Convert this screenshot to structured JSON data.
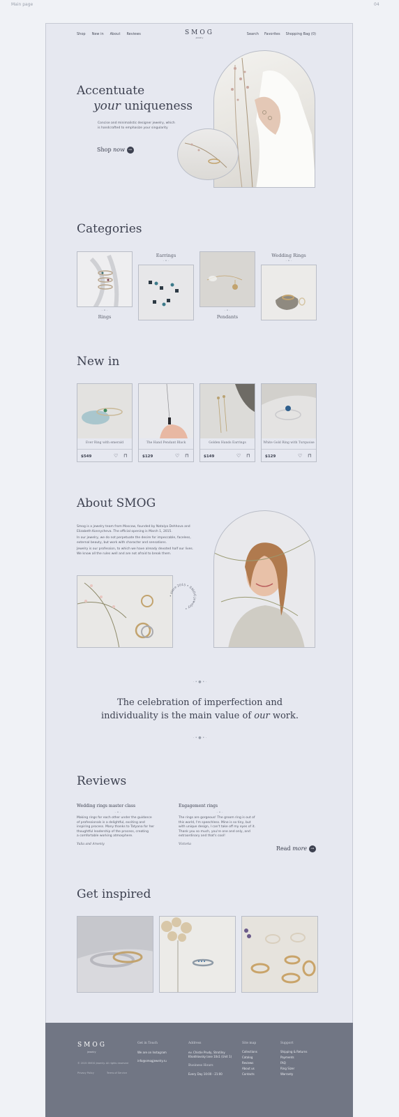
{
  "canvas": {
    "label": "Main page",
    "page_number": "04"
  },
  "nav": {
    "left": [
      "Shop",
      "New in",
      "About",
      "Reviews"
    ],
    "logo": "SMOG",
    "logo_sub": "jewelry",
    "right": [
      "Search",
      "Favorites",
      "Shopping Bag (0)"
    ]
  },
  "hero": {
    "title_line1": "Accentuate",
    "title_em": "your",
    "title_rest": "uniqueness",
    "subtitle_line1": "Concise and minimalistic designer jewelry, which",
    "subtitle_line2": "is handcrafted to emphasize your singularity",
    "cta_text": "Shop",
    "cta_em": "now",
    "cta_icon": "arrow-right-icon"
  },
  "categories": {
    "title": "Categories",
    "items": [
      {
        "label": "Rings"
      },
      {
        "label": "Earrings"
      },
      {
        "label": "Pendants"
      },
      {
        "label": "Wedding Rings"
      }
    ]
  },
  "new_in": {
    "title": "New in",
    "products": [
      {
        "name": "Ever Ring with emerald",
        "price": "$549"
      },
      {
        "name": "The Hand Pendant Black",
        "price": "$129"
      },
      {
        "name": "Golden Hands Earrings",
        "price": "$149"
      },
      {
        "name": "White Gold Ring with Turquoise",
        "price": "$129"
      }
    ]
  },
  "about": {
    "title": "About SMOG",
    "p1_lines": [
      "Smog is a jewelry team from Moscow, founded by Natalya Dehhova and",
      "Elizabeth Konnycheva. The official opening is March 1, 2015."
    ],
    "p2_lines": [
      "In our jewelry, we do not perpetuate the desire for impeccable, faceless,",
      "external beauty, but work with character and sensations."
    ],
    "p3_lines": [
      "Jewelry is our profession, to which we have already devoted half our lives.",
      "We know all the rules well and are not afraid to break them."
    ],
    "stamp": "• since 2015 • SMOG jewelry •"
  },
  "quote": {
    "line1": "The celebration of imperfection and",
    "line2_pre": "individuality is the main value of",
    "line2_em": "our",
    "line2_post": "work."
  },
  "reviews": {
    "title": "Reviews",
    "items": [
      {
        "heading": "Wedding rings master class",
        "lines": [
          "Making rings for each other under the guidance",
          "of professionals is a delightful, exciting and",
          "inspiring process. Many thanks to Tatyana for her",
          "thoughtful leadership of the process, creating",
          "a comfortable working atmosphere."
        ],
        "author": "Yulia and Arseniy"
      },
      {
        "heading": "Engagement rings",
        "lines": [
          "The rings are gorgeous! The groom ring is out of",
          "this world, I'm speechless. Mine is so tiny, but",
          "with unique design, I can't take off my eyes of it.",
          "Thank you so much, you're one and only, and",
          "extraordinary and that's cool!"
        ],
        "author": "Victoria"
      }
    ],
    "read_more": "Read",
    "read_more_em": "more"
  },
  "inspired": {
    "title": "Get inspired"
  },
  "footer": {
    "logo": "SMOG",
    "logo_sub": "jewelry",
    "copyright": "© 2015 SMOG Jewelry. All rights reserved",
    "privacy": "Privacy Policy",
    "terms": "Terms of Service",
    "touch_title": "Get in Touch",
    "touch_items": [
      "We are on Instagram",
      "info@smogjewelry.ru"
    ],
    "address_title": "Address",
    "address_lines": [
      "ev. Chistie Prudy, Strotilny",
      "Khokhlovsky lane 10s1 (Unit 1)"
    ],
    "hours_title": "Business Hours",
    "hours": "Every Day 10:00 - 21:00",
    "sitemap_title": "Site map",
    "sitemap": [
      "Collections",
      "Catalog",
      "Reviews",
      "About us",
      "Contacts"
    ],
    "support_title": "Support",
    "support": [
      "Shipping & Returns",
      "Payments",
      "FAQ",
      "Ring Sizer",
      "Warranty"
    ]
  },
  "colors": {
    "background": "#f0f2f6",
    "frame": "#e6e8f0",
    "text": "#3d4150",
    "footer": "#717684"
  }
}
